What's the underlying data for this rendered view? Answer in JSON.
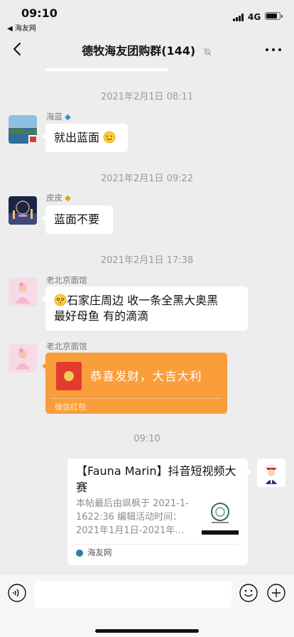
{
  "status_bar": {
    "time": "09:10",
    "back_app": "◀ 海友网",
    "network": "4G"
  },
  "nav": {
    "title": "德牧海友团购群",
    "member_count": "(144)"
  },
  "messages": [
    {
      "type": "timestamp",
      "text": "2021年2月1日 08:11"
    },
    {
      "type": "text",
      "sender": "海蓝",
      "text": "就出蓝面"
    },
    {
      "type": "timestamp",
      "text": "2021年2月1日 09:22"
    },
    {
      "type": "text",
      "sender": "皮皮",
      "text": "蓝面不要"
    },
    {
      "type": "timestamp",
      "text": "2021年2月1日 17:38"
    },
    {
      "type": "text",
      "sender": "老北京面馆",
      "line1": "石家庄周边 收一条全黑大奥黑",
      "line2": "最好母鱼  有的滴滴"
    },
    {
      "type": "red_packet",
      "sender": "老北京面馆",
      "text": "恭喜发财，大吉大利",
      "footer": "微信红包"
    },
    {
      "type": "timestamp",
      "text": "09:10"
    },
    {
      "type": "link_card",
      "title": "【Fauna Marin】抖音短视频大赛",
      "desc": "本帖最后由飒枫于 2021-1-1622:36 编辑活动时间：2021年1月1日-2021年…",
      "source": "海友网"
    }
  ],
  "colors": {
    "background": "#ededed",
    "red_packet": "#fa9d3b",
    "timestamp": "#9a9a9a"
  },
  "icons": [
    "back-arrow-icon",
    "mute-bell-icon",
    "more-icon",
    "voice-icon",
    "emoji-icon",
    "plus-icon",
    "red-packet-icon"
  ]
}
